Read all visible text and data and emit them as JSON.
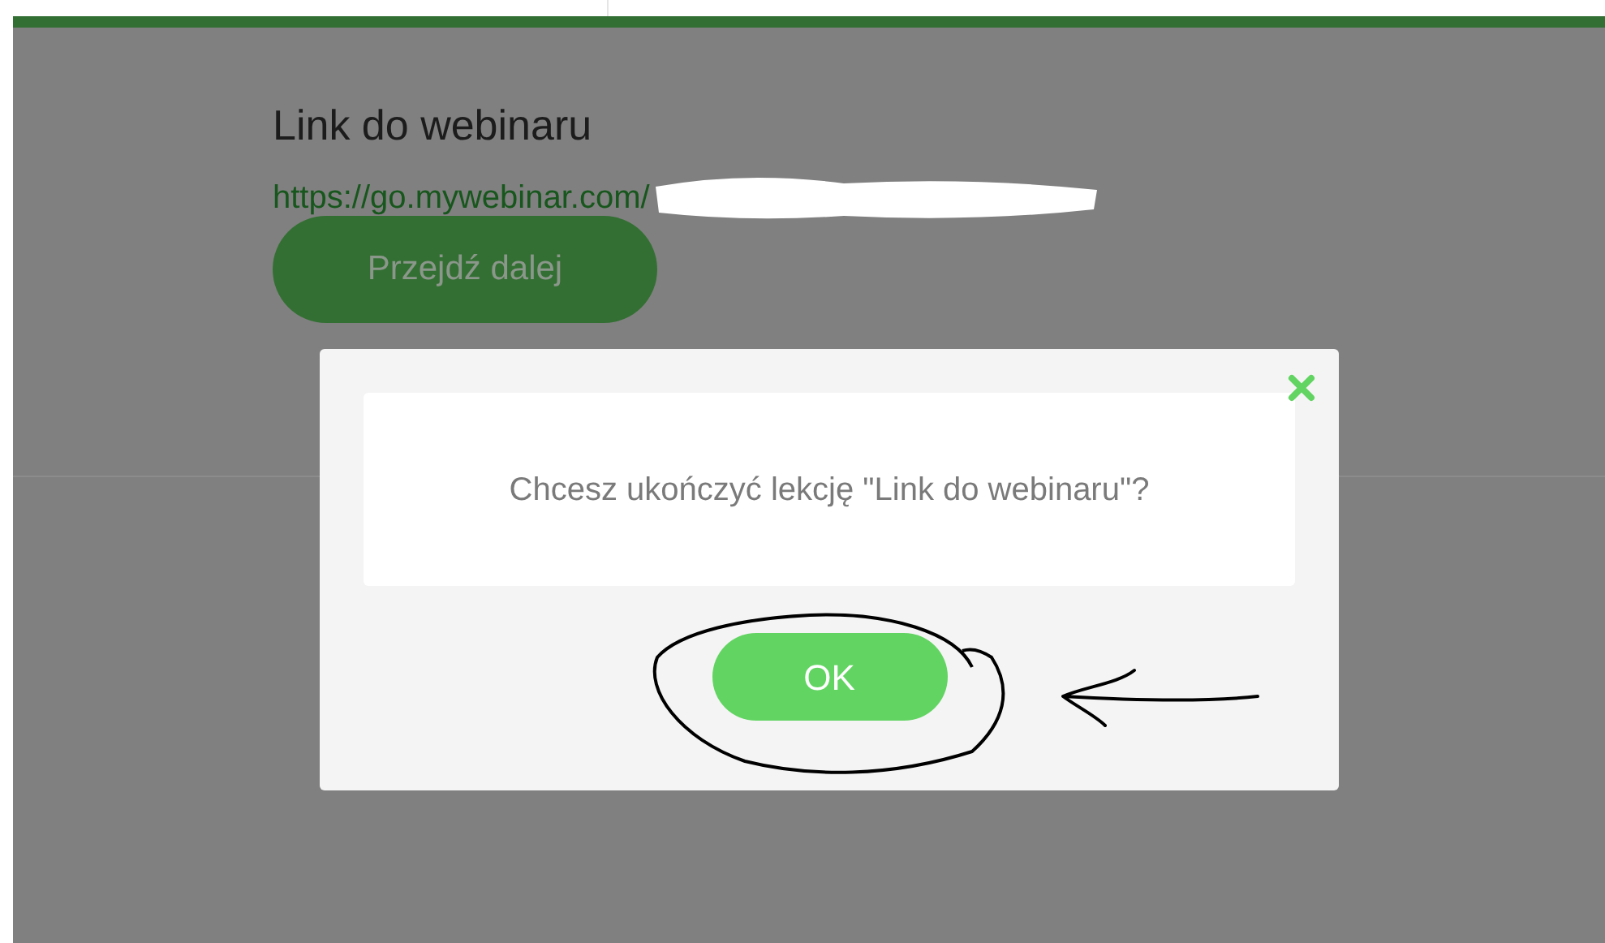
{
  "lesson": {
    "title": "Link do webinaru",
    "link": "https://go.mywebinar.com/",
    "link_redacted": true,
    "button": "Przejdź dalej"
  },
  "dialog": {
    "message": "Chcesz ukończyć lekcję \"Link do webinaru\"?",
    "ok_button": "OK"
  }
}
